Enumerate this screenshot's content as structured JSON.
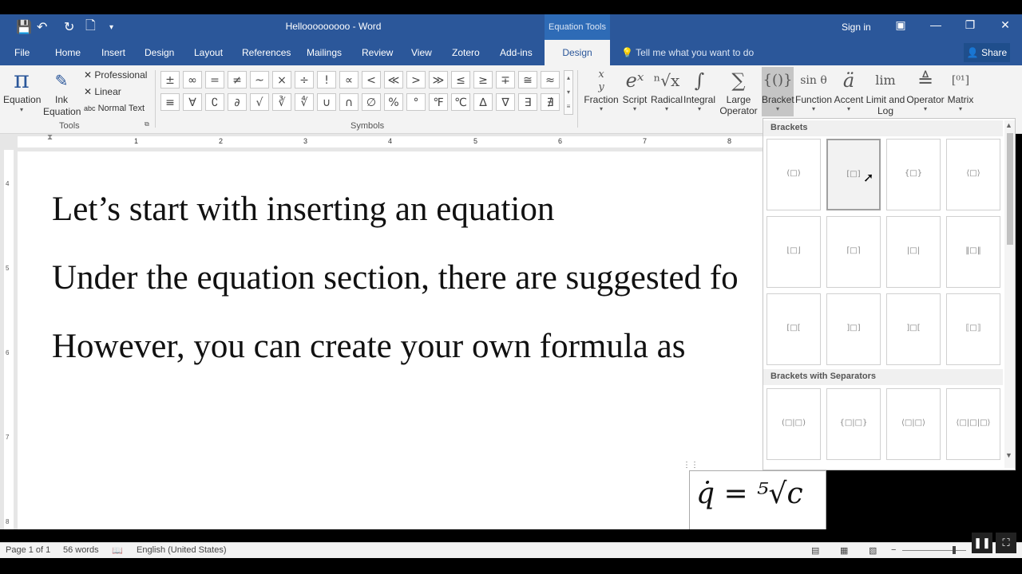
{
  "window": {
    "doc_title": "Hellooooooooo - Word",
    "context_tab_group": "Equation Tools",
    "sign_in": "Sign in"
  },
  "tabs": [
    {
      "label": "File"
    },
    {
      "label": "Home"
    },
    {
      "label": "Insert"
    },
    {
      "label": "Design"
    },
    {
      "label": "Layout"
    },
    {
      "label": "References"
    },
    {
      "label": "Mailings"
    },
    {
      "label": "Review"
    },
    {
      "label": "View"
    },
    {
      "label": "Zotero"
    },
    {
      "label": "Add-ins"
    },
    {
      "label": "Design",
      "active": true
    }
  ],
  "tell_me": "Tell me what you want to do",
  "share": "Share",
  "tools_group": {
    "label": "Tools",
    "equation": "Equation",
    "ink_equation_1": "Ink",
    "ink_equation_2": "Equation",
    "professional": "Professional",
    "linear": "Linear",
    "normal_text": "Normal Text"
  },
  "symbols_group": {
    "label": "Symbols",
    "row1": [
      "±",
      "∞",
      "=",
      "≠",
      "~",
      "×",
      "÷",
      "!",
      "∝",
      "<",
      "≪",
      ">",
      "≫",
      "≤",
      "≥",
      "∓",
      "≅",
      "≈"
    ],
    "row2": [
      "≡",
      "∀",
      "∁",
      "∂",
      "√",
      "∛",
      "∜",
      "∪",
      "∩",
      "∅",
      "%",
      "°",
      "℉",
      "℃",
      "∆",
      "∇",
      "∃",
      "∄"
    ]
  },
  "structures": [
    {
      "label": "Fraction",
      "glyph": "x/y"
    },
    {
      "label": "Script",
      "glyph": "eˣ"
    },
    {
      "label": "Radical",
      "glyph": "ⁿ√x"
    },
    {
      "label": "Integral",
      "glyph": "∫"
    },
    {
      "label": "Large",
      "label2": "Operator",
      "glyph": "∑"
    },
    {
      "label": "Bracket",
      "glyph": "{()}"
    },
    {
      "label": "Function",
      "glyph": "sin θ"
    },
    {
      "label": "Accent",
      "glyph": "ä"
    },
    {
      "label": "Limit and",
      "label2": "Log",
      "glyph": "lim"
    },
    {
      "label": "Operator",
      "glyph": "≜"
    },
    {
      "label": "Matrix",
      "glyph": "[10 01]"
    }
  ],
  "ruler_numbers": [
    "1",
    "2",
    "3",
    "4",
    "5",
    "6",
    "7",
    "8"
  ],
  "vertical_ruler_numbers": [
    "4",
    "5",
    "6",
    "7",
    "8"
  ],
  "document": {
    "paragraphs": [
      "Let’s start with inserting an equation",
      "Under the equation section, there are suggested fo",
      "However, you can create your own formula as"
    ],
    "equation": "q̇ = ⁵√c"
  },
  "gallery": {
    "section1": "Brackets",
    "brackets": [
      "(□)",
      "[□]",
      "{□}",
      "⟨□⟩",
      "⌊□⌋",
      "⌈□⌉",
      "|□|",
      "‖□‖",
      "[□[",
      "]□]",
      "]□[",
      "⟦□⟧"
    ],
    "section2": "Brackets with Separators",
    "separators": [
      "(□|□)",
      "{□|□}",
      "⟨□|□⟩",
      "⟨□|□|□⟩"
    ]
  },
  "status": {
    "page": "Page 1 of 1",
    "words": "56 words",
    "language": "English (United States)"
  },
  "colors": {
    "accent": "#2b579a"
  }
}
